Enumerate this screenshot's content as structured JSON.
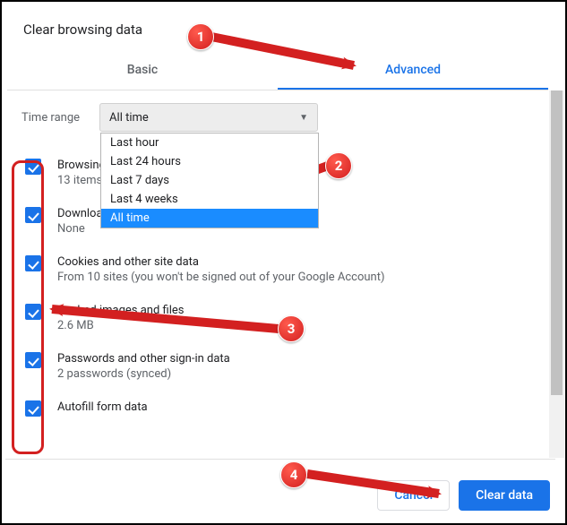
{
  "dialog": {
    "title": "Clear browsing data",
    "tabs": {
      "basic": "Basic",
      "advanced": "Advanced"
    },
    "time_range_label": "Time range",
    "select": {
      "value": "All time",
      "options": [
        "Last hour",
        "Last 24 hours",
        "Last 7 days",
        "Last 4 weeks",
        "All time"
      ],
      "selected_index": 4
    },
    "items": [
      {
        "title": "Browsing history",
        "sub": "13 items"
      },
      {
        "title": "Download history",
        "sub": "None"
      },
      {
        "title": "Cookies and other site data",
        "sub": "From 10 sites (you won't be signed out of your Google Account)"
      },
      {
        "title": "Cached images and files",
        "sub": "2.6 MB"
      },
      {
        "title": "Passwords and other sign-in data",
        "sub": "2 passwords (synced)"
      },
      {
        "title": "Autofill form data",
        "sub": ""
      }
    ],
    "buttons": {
      "cancel": "Cancel",
      "clear": "Clear data"
    }
  },
  "annotations": {
    "b1": "1",
    "b2": "2",
    "b3": "3",
    "b4": "4"
  }
}
